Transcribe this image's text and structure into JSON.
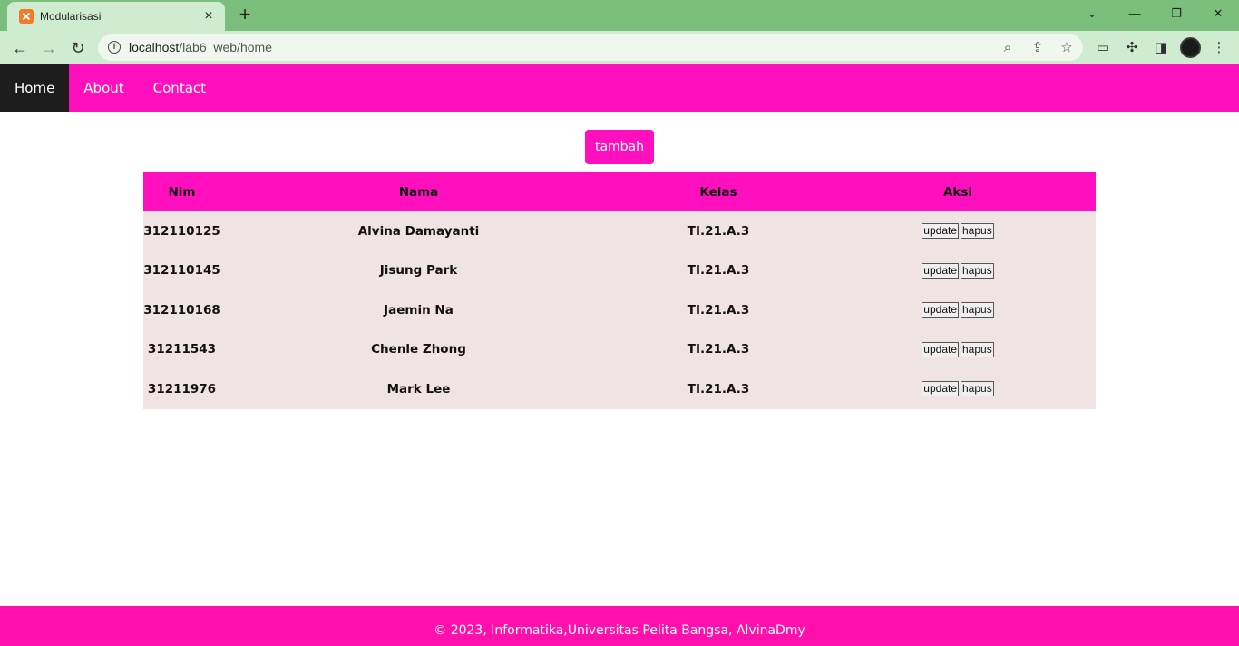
{
  "browser": {
    "tab_title": "Modularisasi",
    "url_host": "localhost",
    "url_path": "/lab6_web/home"
  },
  "nav": {
    "items": [
      {
        "label": "Home"
      },
      {
        "label": "About"
      },
      {
        "label": "Contact"
      }
    ]
  },
  "actions": {
    "add_label": "tambah"
  },
  "table": {
    "headers": [
      "Nim",
      "Nama",
      "Kelas",
      "Aksi"
    ],
    "rows": [
      {
        "nim": "312110125",
        "nama": "Alvina Damayanti",
        "kelas": "TI.21.A.3"
      },
      {
        "nim": "312110145",
        "nama": "Jisung Park",
        "kelas": "TI.21.A.3"
      },
      {
        "nim": "312110168",
        "nama": "Jaemin Na",
        "kelas": "TI.21.A.3"
      },
      {
        "nim": "31211543",
        "nama": "Chenle Zhong",
        "kelas": "TI.21.A.3"
      },
      {
        "nim": "31211976",
        "nama": "Mark Lee",
        "kelas": "TI.21.A.3"
      }
    ],
    "update_label": "update",
    "delete_label": "hapus"
  },
  "footer": {
    "text": "© 2023, Informatika,Universitas Pelita Bangsa, AlvinaDmy"
  },
  "colors": {
    "accent": "#ff0fbe",
    "nav_active": "#1d1d1d",
    "row_bg": "#efe3e4"
  }
}
